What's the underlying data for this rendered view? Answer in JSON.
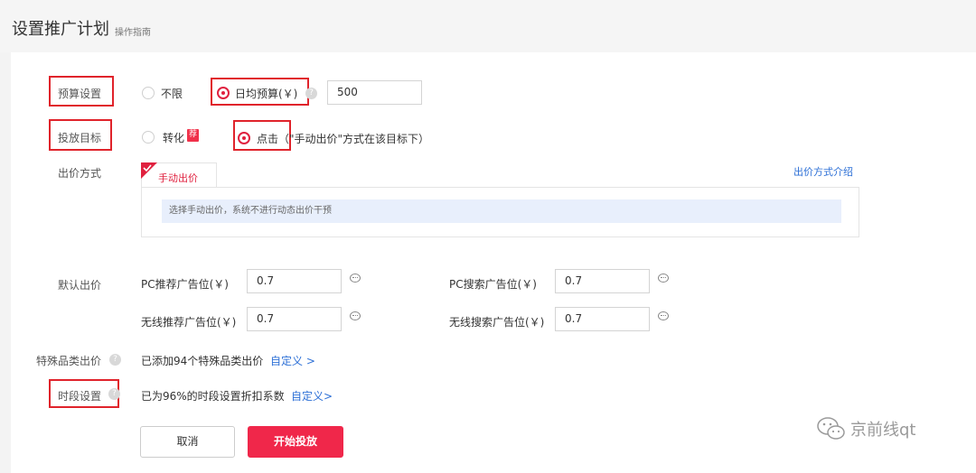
{
  "header": {
    "title": "设置推广计划",
    "guide": "操作指南"
  },
  "budget": {
    "label": "预算设置",
    "option_unlimited": "不限",
    "option_daily": "日均预算(￥)",
    "value": "500"
  },
  "goal": {
    "label": "投放目标",
    "option_convert": "转化",
    "badge": "荐",
    "option_click": "点击（\"手动出价\"方式在该目标下）"
  },
  "bidding": {
    "label": "出价方式",
    "tab": "手动出价",
    "intro_link": "出价方式介绍",
    "tip": "选择手动出价，系统不进行动态出价干预"
  },
  "default_bid": {
    "label": "默认出价",
    "pc_recommend_label": "PC推荐广告位(￥)",
    "pc_recommend_value": "0.7",
    "pc_search_label": "PC搜索广告位(￥)",
    "pc_search_value": "0.7",
    "wireless_recommend_label": "无线推荐广告位(￥)",
    "wireless_recommend_value": "0.7",
    "wireless_search_label": "无线搜索广告位(￥)",
    "wireless_search_value": "0.7"
  },
  "special": {
    "label": "特殊品类出价",
    "text": "已添加94个特殊品类出价",
    "link": "自定义 >"
  },
  "timeslot": {
    "label": "时段设置",
    "text": "已为96%的时段设置折扣系数",
    "link": "自定义>"
  },
  "buttons": {
    "cancel": "取消",
    "start": "开始投放"
  },
  "watermark": "京前线qt",
  "colors": {
    "accent": "#f0274a",
    "link": "#2c6fd6",
    "highlight_box": "#e0232b"
  }
}
